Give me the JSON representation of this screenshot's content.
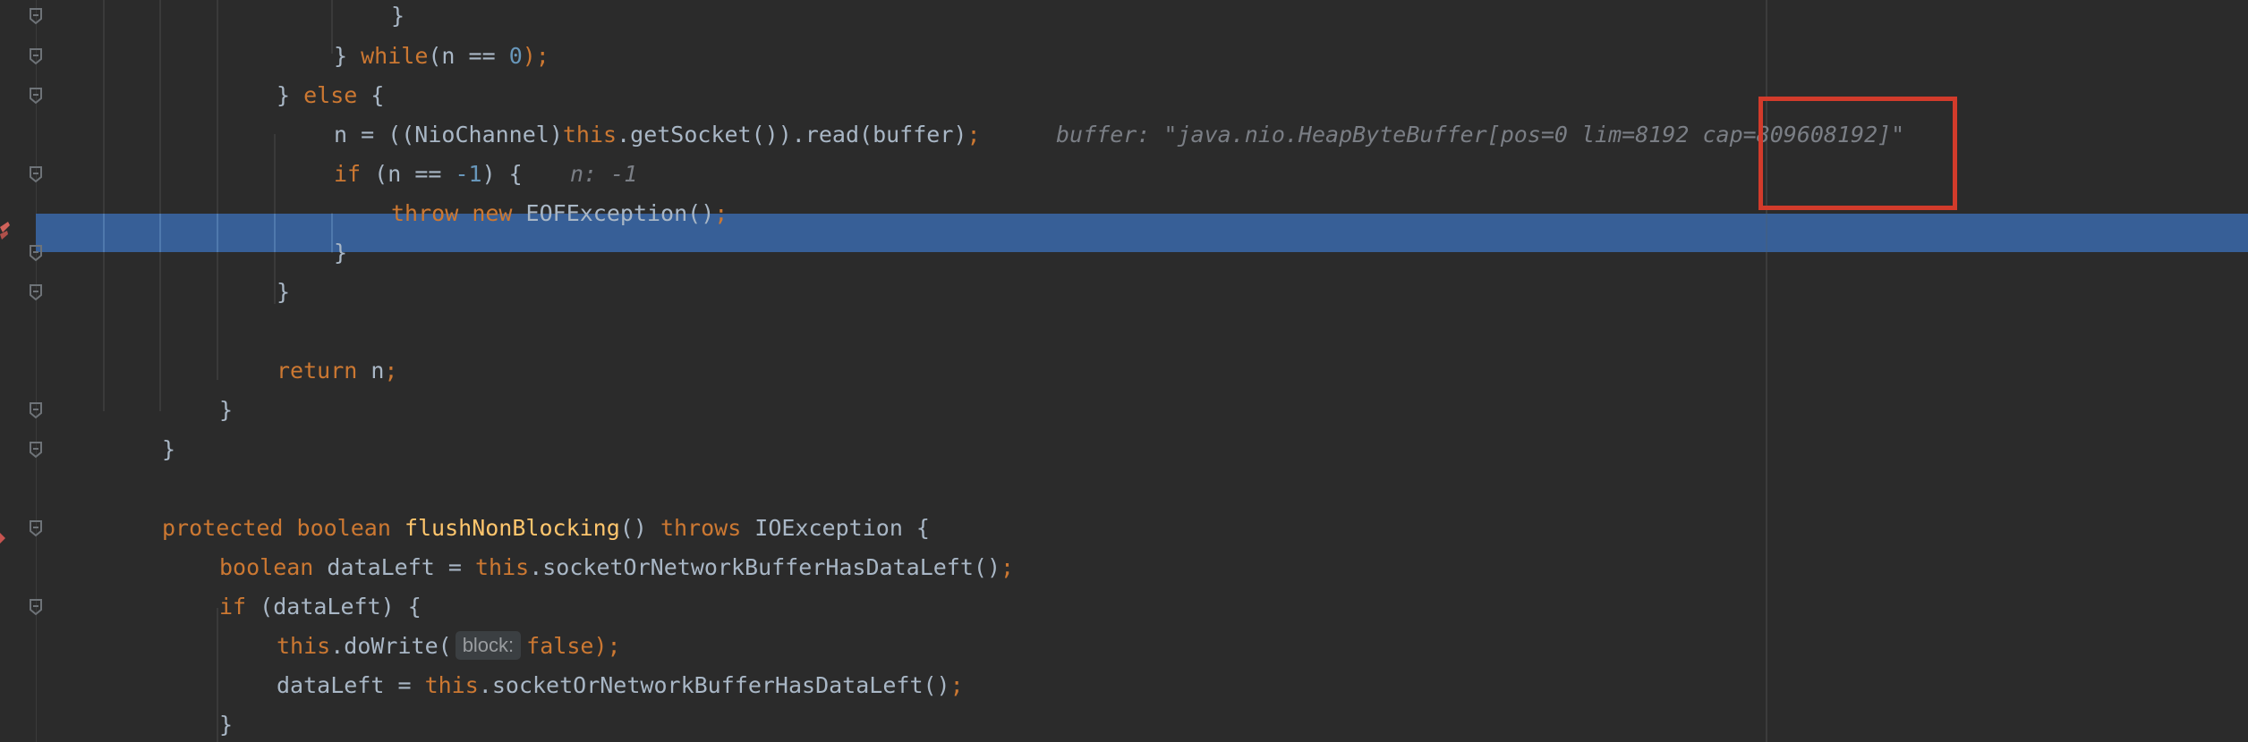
{
  "editor": {
    "lines": [
      {
        "tokens": [
          {
            "t": "}",
            "c": "plain"
          }
        ]
      },
      {
        "tokens": [
          {
            "t": "} ",
            "c": "plain"
          },
          {
            "t": "while",
            "c": "kw"
          },
          {
            "t": "(n == ",
            "c": "plain"
          },
          {
            "t": "0",
            "c": "num"
          },
          {
            "t": ");",
            "c": "kw"
          }
        ]
      },
      {
        "tokens": [
          {
            "t": "} ",
            "c": "plain"
          },
          {
            "t": "else",
            "c": "kw"
          },
          {
            "t": " {",
            "c": "plain"
          }
        ]
      },
      {
        "tokens": [
          {
            "t": "n = ((NioChannel)",
            "c": "plain"
          },
          {
            "t": "this",
            "c": "kw"
          },
          {
            "t": ".getSocket()).read(buffer)",
            "c": "plain"
          },
          {
            "t": ";",
            "c": "kw"
          }
        ],
        "hint": "buffer: \"java.nio.HeapByteBuffer[pos=0 lim=8192 cap=809608192]\""
      },
      {
        "tokens": [
          {
            "t": "if",
            "c": "kw"
          },
          {
            "t": " (n == ",
            "c": "plain"
          },
          {
            "t": "-1",
            "c": "num"
          },
          {
            "t": ") {",
            "c": "plain"
          }
        ],
        "hint": "n: -1"
      },
      {
        "tokens": [
          {
            "t": "throw",
            "c": "kw"
          },
          {
            "t": " ",
            "c": "plain"
          },
          {
            "t": "new",
            "c": "kw"
          },
          {
            "t": " EOFException()",
            "c": "plain"
          },
          {
            "t": ";",
            "c": "kw"
          }
        ],
        "current": true
      },
      {
        "tokens": [
          {
            "t": "}",
            "c": "plain"
          }
        ]
      },
      {
        "tokens": [
          {
            "t": "}",
            "c": "plain"
          }
        ]
      },
      {
        "tokens": []
      },
      {
        "tokens": [
          {
            "t": "return",
            "c": "kw"
          },
          {
            "t": " n",
            "c": "plain"
          },
          {
            "t": ";",
            "c": "kw"
          }
        ]
      },
      {
        "tokens": [
          {
            "t": "}",
            "c": "plain"
          }
        ]
      },
      {
        "tokens": [
          {
            "t": "}",
            "c": "plain"
          }
        ]
      },
      {
        "tokens": []
      },
      {
        "tokens": [
          {
            "t": "protected",
            "c": "kw"
          },
          {
            "t": " ",
            "c": "plain"
          },
          {
            "t": "boolean",
            "c": "kw"
          },
          {
            "t": " ",
            "c": "plain"
          },
          {
            "t": "flushNonBlocking",
            "c": "fn"
          },
          {
            "t": "() ",
            "c": "plain"
          },
          {
            "t": "throws",
            "c": "kw"
          },
          {
            "t": " IOException {",
            "c": "plain"
          }
        ]
      },
      {
        "tokens": [
          {
            "t": "boolean",
            "c": "kw"
          },
          {
            "t": " dataLeft = ",
            "c": "plain"
          },
          {
            "t": "this",
            "c": "kw"
          },
          {
            "t": ".socketOrNetworkBufferHasDataLeft()",
            "c": "plain"
          },
          {
            "t": ";",
            "c": "kw"
          }
        ]
      },
      {
        "tokens": [
          {
            "t": "if",
            "c": "kw"
          },
          {
            "t": " (dataLeft) {",
            "c": "plain"
          }
        ]
      },
      {
        "tokens": [
          {
            "t": "this",
            "c": "kw"
          },
          {
            "t": ".doWrite(",
            "c": "plain"
          },
          {
            "t": "block:",
            "c": "param"
          },
          {
            "t": "false",
            "c": "kw"
          },
          {
            "t": ");",
            "c": "kw"
          }
        ]
      },
      {
        "tokens": [
          {
            "t": "dataLeft = ",
            "c": "plain"
          },
          {
            "t": "this",
            "c": "kw"
          },
          {
            "t": ".socketOrNetworkBufferHasDataLeft()",
            "c": "plain"
          },
          {
            "t": ";",
            "c": "kw"
          }
        ]
      },
      {
        "tokens": [
          {
            "t": "}",
            "c": "plain"
          }
        ]
      }
    ]
  },
  "colors": {
    "background": "#2b2b2b",
    "keyword": "#cc7832",
    "number": "#6897bb",
    "function": "#ffc66d",
    "text": "#a9b7c6",
    "execution_line": "#375f97",
    "annotation_box": "#d23b2b"
  },
  "icons": {
    "fold": "fold-marker-icon",
    "breakpoint": "execution-point-icon"
  }
}
